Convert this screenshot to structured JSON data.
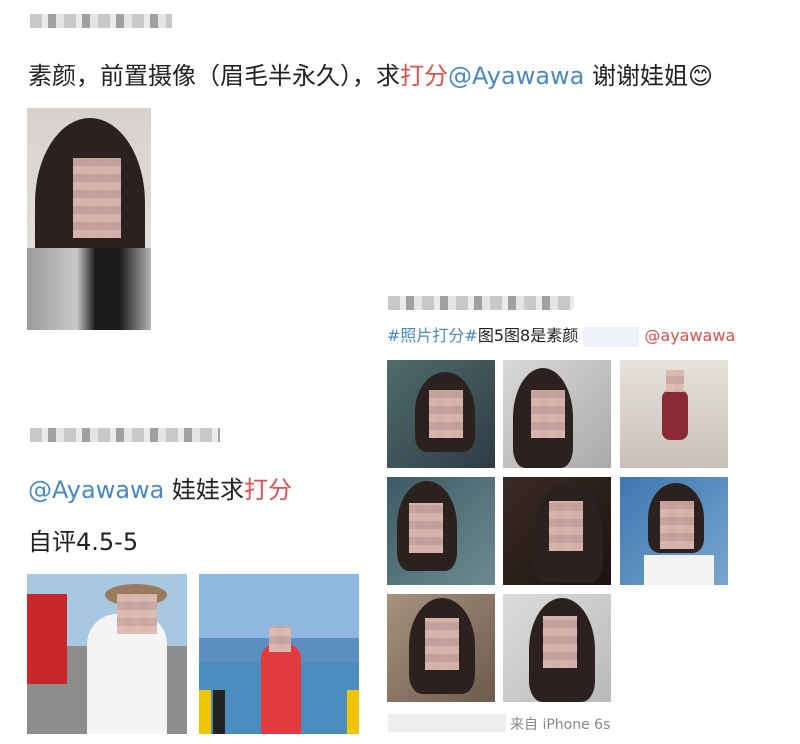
{
  "post1": {
    "text_a": "素颜，前置摄像（眉毛半永久），求",
    "text_b": "打分",
    "text_c": "@Ayawawa",
    "text_d": " 谢谢娃姐",
    "emoji": "😊"
  },
  "post2": {
    "mention": "@Ayawawa",
    "text_a": " 娃娃求",
    "text_b": "打分",
    "line2": "自评4.5-5"
  },
  "post3": {
    "hashtag": "#照片打分#",
    "text": "图5图8是素颜",
    "mention": "@ayawawa",
    "source": "来自 iPhone 6s"
  },
  "colors": {
    "accent_red": "#e0504c",
    "link_blue": "#4a88c8"
  }
}
